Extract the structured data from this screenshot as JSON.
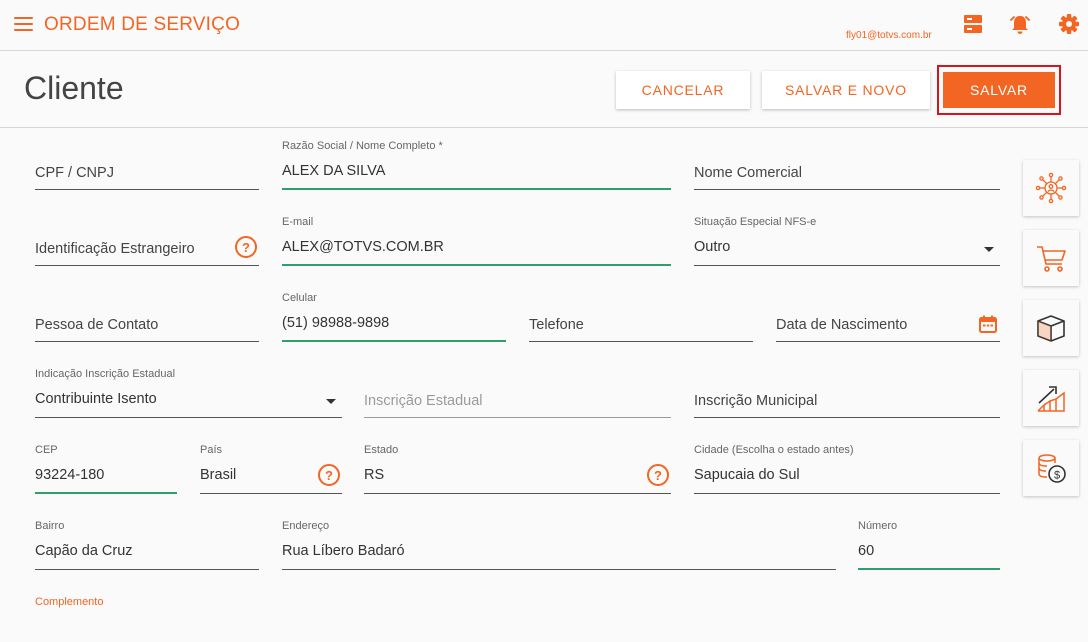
{
  "app": {
    "title": "ORDEM DE SERVIÇO",
    "user_email": "fly01@totvs.com.br"
  },
  "page": {
    "title": "Cliente"
  },
  "actions": {
    "cancel": "CANCELAR",
    "save_new": "SALVAR E NOVO",
    "save": "SALVAR"
  },
  "form": {
    "cpf_cnpj": {
      "placeholder": "CPF / CNPJ",
      "value": ""
    },
    "razao_social": {
      "label": "Razão Social / Nome Completo *",
      "value": "ALEX DA SILVA"
    },
    "nome_comercial": {
      "placeholder": "Nome Comercial",
      "value": ""
    },
    "identificacao_estrangeiro": {
      "placeholder": "Identificação Estrangeiro",
      "value": ""
    },
    "email": {
      "label": "E-mail",
      "value": "ALEX@TOTVS.COM.BR"
    },
    "situacao_nfse": {
      "label": "Situação Especial NFS-e",
      "value": "Outro"
    },
    "pessoa_contato": {
      "placeholder": "Pessoa de Contato",
      "value": ""
    },
    "celular": {
      "label": "Celular",
      "value": "(51) 98988-9898"
    },
    "telefone": {
      "placeholder": "Telefone",
      "value": ""
    },
    "data_nascimento": {
      "placeholder": "Data de Nascimento",
      "value": ""
    },
    "indicacao_ie": {
      "label": "Indicação Inscrição Estadual",
      "value": "Contribuinte Isento"
    },
    "inscricao_estadual": {
      "placeholder": "Inscrição Estadual",
      "value": ""
    },
    "inscricao_municipal": {
      "placeholder": "Inscrição Municipal",
      "value": ""
    },
    "cep": {
      "label": "CEP",
      "value": "93224-180"
    },
    "pais": {
      "label": "País",
      "value": "Brasil"
    },
    "estado": {
      "label": "Estado",
      "value": "RS"
    },
    "cidade": {
      "label": "Cidade (Escolha o estado antes)",
      "value": "Sapucaia do Sul"
    },
    "bairro": {
      "label": "Bairro",
      "value": "Capão da Cruz"
    },
    "endereco": {
      "label": "Endereço",
      "value": "Rua Líbero Badaró"
    },
    "numero": {
      "label": "Número",
      "value": "60"
    },
    "complemento": {
      "label": "Complemento"
    }
  },
  "help_glyph": "?",
  "side_buttons": [
    "network-user-icon",
    "shopping-cart-icon",
    "package-box-icon",
    "growth-chart-icon",
    "coins-dollar-icon"
  ],
  "colors": {
    "accent": "#f26522",
    "active_underline": "#2e9e6b",
    "highlight_border": "#d7141e"
  }
}
